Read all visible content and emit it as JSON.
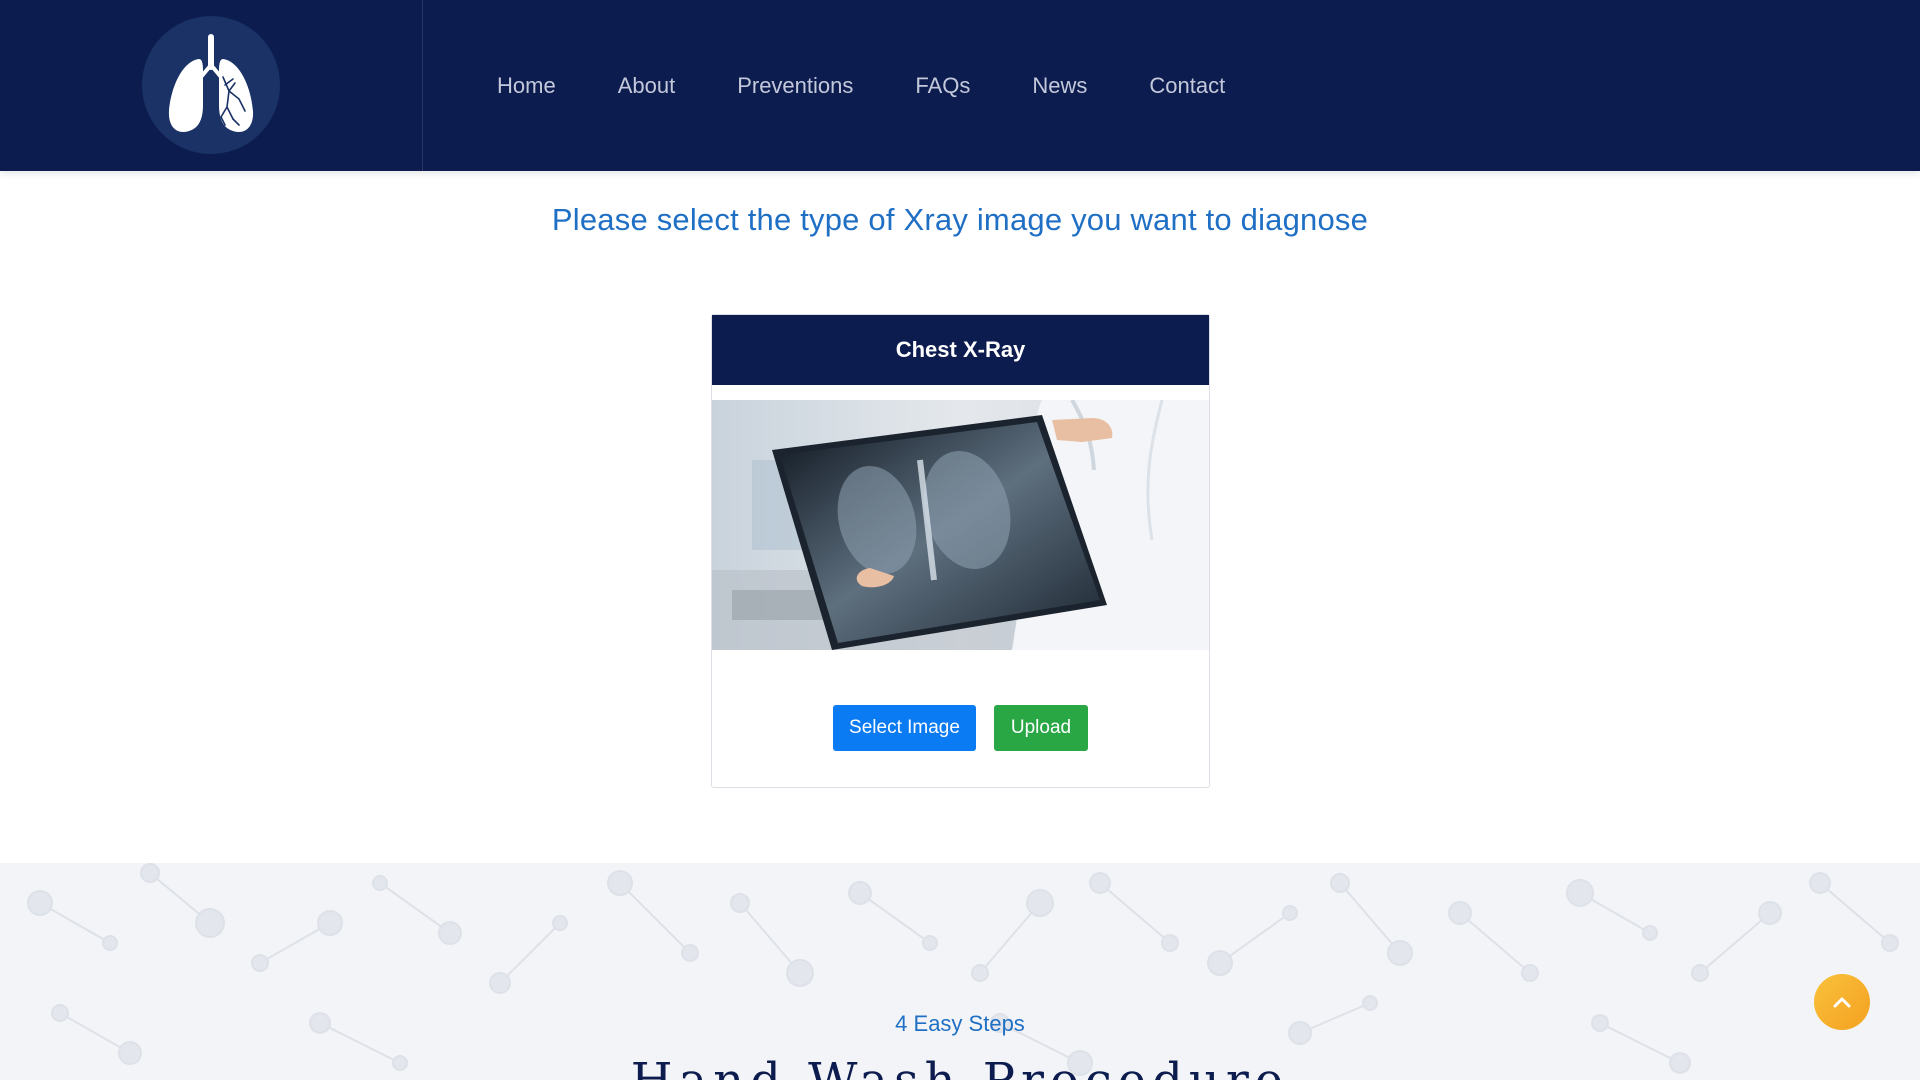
{
  "header": {
    "logo_icon": "lungs-icon",
    "nav": [
      {
        "label": "Home"
      },
      {
        "label": "About"
      },
      {
        "label": "Preventions"
      },
      {
        "label": "FAQs"
      },
      {
        "label": "News"
      },
      {
        "label": "Contact"
      }
    ]
  },
  "main": {
    "prompt": "Please select the type of Xray image you want to diagnose",
    "card": {
      "title": "Chest X-Ray",
      "select_label": "Select Image",
      "upload_label": "Upload"
    }
  },
  "steps": {
    "kicker": "4 Easy Steps",
    "title": "Hand Wash Procedure"
  },
  "back_to_top": {
    "icon": "chevron-up-icon"
  },
  "colors": {
    "header_bg": "#0d1c4f",
    "accent_blue": "#1f6fc5",
    "button_blue": "#0a7bf2",
    "button_green": "#29a745",
    "to_top": "#f9b233"
  }
}
